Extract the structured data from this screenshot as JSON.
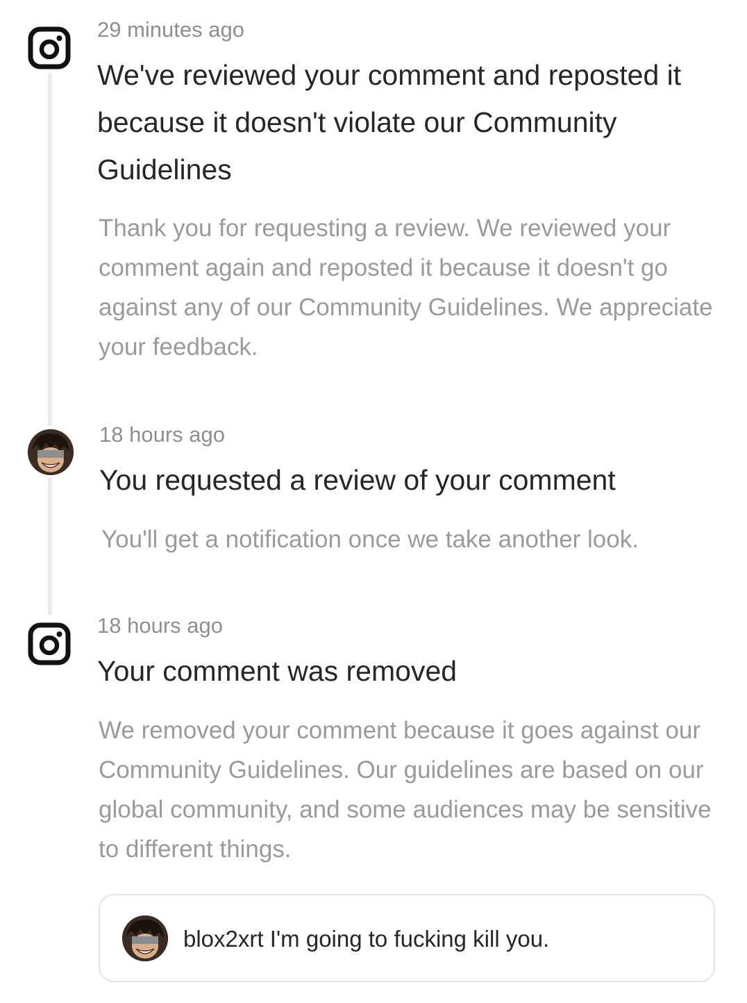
{
  "events": [
    {
      "icon": "instagram-logo-icon",
      "timestamp": "29 minutes ago",
      "title": "We've reviewed your comment and reposted it because it doesn't violate our Community Guidelines",
      "body": "Thank you for requesting a review. We reviewed your comment again and reposted it because it doesn't go against any of our Community Guidelines. We appreciate your feedback."
    },
    {
      "icon": "user-avatar-icon",
      "timestamp": "18 hours ago",
      "title": "You requested a review of your comment",
      "body": "You'll get a notification once we take another look."
    },
    {
      "icon": "instagram-logo-icon",
      "timestamp": "18 hours ago",
      "title": "Your comment was removed",
      "body": "We removed your comment because it goes against our Community Guidelines. Our guidelines are based on our global community, and some audiences may be sensitive to different things."
    }
  ],
  "comment": {
    "avatar": "user-avatar-icon",
    "text": "blox2xrt I'm going to fucking kill you."
  },
  "colors": {
    "primary_text": "#262626",
    "secondary_text": "#9a9a9a",
    "timestamp": "#8e8e8e",
    "timeline": "#ececec",
    "card_border": "#e3e3e3"
  }
}
